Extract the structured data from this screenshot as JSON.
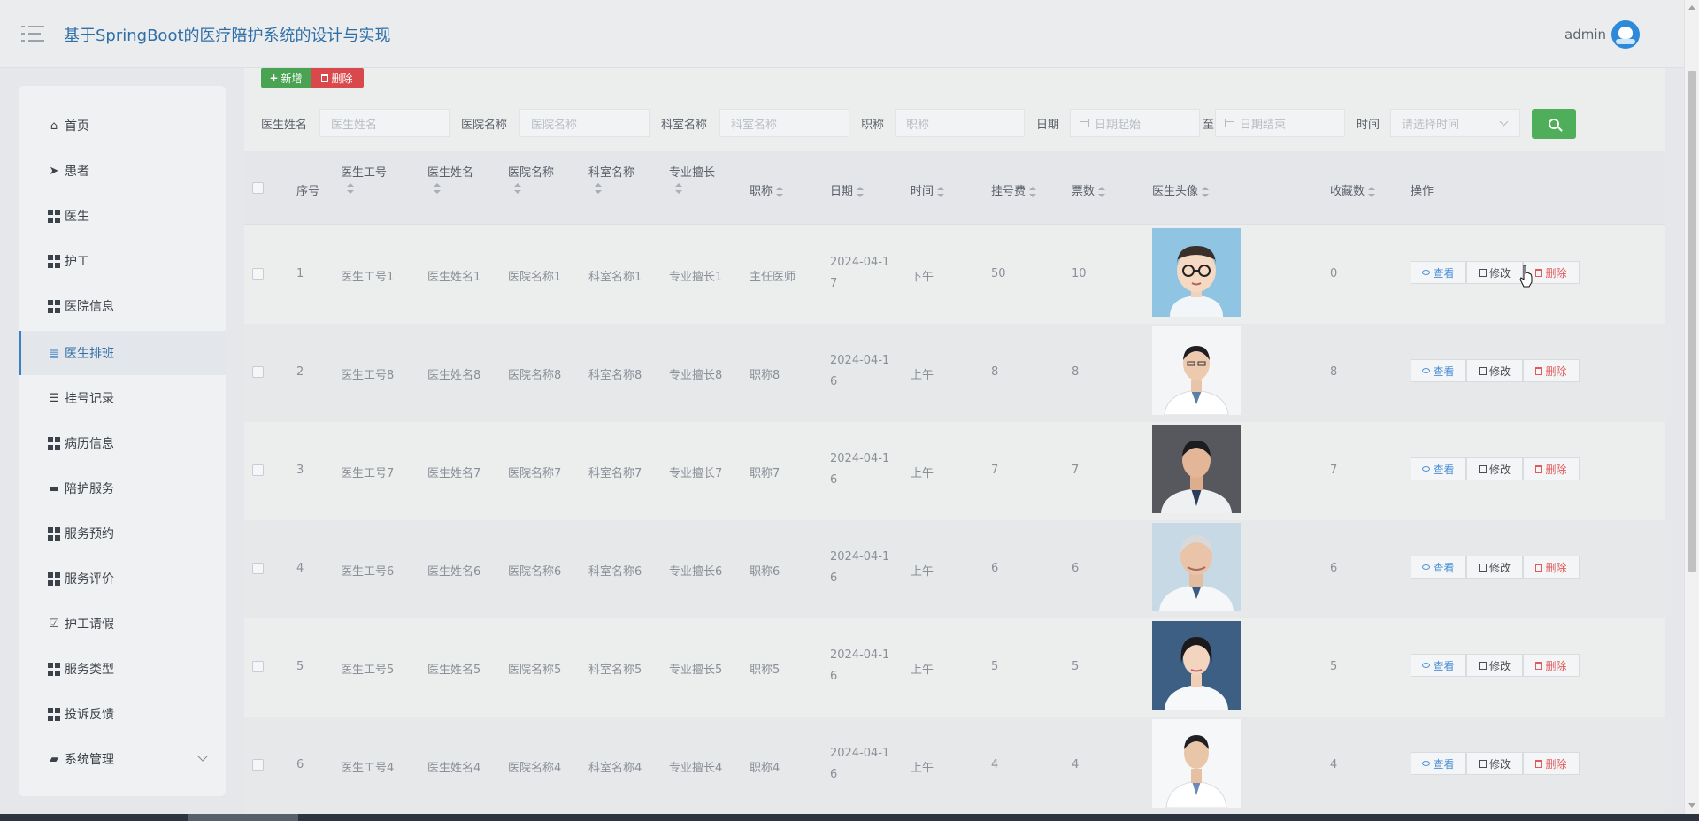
{
  "header": {
    "title": "基于SpringBoot的医疗陪护系统的设计与实现",
    "user": "admin"
  },
  "sidebar": {
    "items": [
      {
        "label": "首页",
        "icon": "home-icon"
      },
      {
        "label": "患者",
        "icon": "paper-plane-icon"
      },
      {
        "label": "医生",
        "icon": "grid-icon"
      },
      {
        "label": "护工",
        "icon": "grid-icon"
      },
      {
        "label": "医院信息",
        "icon": "grid-icon"
      },
      {
        "label": "医生排班",
        "icon": "clipboard-icon",
        "active": true
      },
      {
        "label": "挂号记录",
        "icon": "sliders-icon"
      },
      {
        "label": "病历信息",
        "icon": "grid-icon"
      },
      {
        "label": "陪护服务",
        "icon": "monitor-icon"
      },
      {
        "label": "服务预约",
        "icon": "grid-icon"
      },
      {
        "label": "服务评价",
        "icon": "grid-icon"
      },
      {
        "label": "护工请假",
        "icon": "checklist-icon"
      },
      {
        "label": "服务类型",
        "icon": "grid-icon"
      },
      {
        "label": "投诉反馈",
        "icon": "grid-icon"
      },
      {
        "label": "系统管理",
        "icon": "briefcase-icon"
      }
    ]
  },
  "toolbar": {
    "add_label": "新增",
    "delete_label": "删除"
  },
  "search": {
    "doctor_name_label": "医生姓名",
    "doctor_name_placeholder": "医生姓名",
    "hospital_label": "医院名称",
    "hospital_placeholder": "医院名称",
    "dept_label": "科室名称",
    "dept_placeholder": "科室名称",
    "title_label": "职称",
    "title_placeholder": "职称",
    "date_label": "日期",
    "date_start_placeholder": "日期起始",
    "date_to": "至",
    "date_end_placeholder": "日期结束",
    "time_label": "时间",
    "time_placeholder": "请选择时间"
  },
  "table": {
    "headers": {
      "index": "序号",
      "doctor_no": "医生工号",
      "doctor_name": "医生姓名",
      "hospital": "医院名称",
      "dept": "科室名称",
      "specialty": "专业擅长",
      "title": "职称",
      "date": "日期",
      "time": "时间",
      "fee": "挂号费",
      "tickets": "票数",
      "photo": "医生头像",
      "favorites": "收藏数",
      "actions": "操作"
    },
    "actions": {
      "view": "查看",
      "edit": "修改",
      "delete": "删除"
    },
    "rows": [
      {
        "index": "1",
        "doctor_no": "医生工号1",
        "doctor_name": "医生姓名1",
        "hospital": "医院名称1",
        "dept": "科室名称1",
        "specialty": "专业擅长1",
        "title": "主任医师",
        "date_a": "2024-04-1",
        "date_b": "7",
        "time": "下午",
        "fee": "50",
        "tickets": "10",
        "favorites": "0",
        "photo": "cartoon-doctor"
      },
      {
        "index": "2",
        "doctor_no": "医生工号8",
        "doctor_name": "医生姓名8",
        "hospital": "医院名称8",
        "dept": "科室名称8",
        "specialty": "专业擅长8",
        "title": "职称8",
        "date_a": "2024-04-1",
        "date_b": "6",
        "time": "上午",
        "fee": "8",
        "tickets": "8",
        "favorites": "8",
        "photo": "doctor-white-bg"
      },
      {
        "index": "3",
        "doctor_no": "医生工号7",
        "doctor_name": "医生姓名7",
        "hospital": "医院名称7",
        "dept": "科室名称7",
        "specialty": "专业擅长7",
        "title": "职称7",
        "date_a": "2024-04-1",
        "date_b": "6",
        "time": "上午",
        "fee": "7",
        "tickets": "7",
        "favorites": "7",
        "photo": "doctor-grey-bg"
      },
      {
        "index": "4",
        "doctor_no": "医生工号6",
        "doctor_name": "医生姓名6",
        "hospital": "医院名称6",
        "dept": "科室名称6",
        "specialty": "专业擅长6",
        "title": "职称6",
        "date_a": "2024-04-1",
        "date_b": "6",
        "time": "上午",
        "fee": "6",
        "tickets": "6",
        "favorites": "6",
        "photo": "doctor-elder-blue-bg"
      },
      {
        "index": "5",
        "doctor_no": "医生工号5",
        "doctor_name": "医生姓名5",
        "hospital": "医院名称5",
        "dept": "科室名称5",
        "specialty": "专业擅长5",
        "title": "职称5",
        "date_a": "2024-04-1",
        "date_b": "6",
        "time": "上午",
        "fee": "5",
        "tickets": "5",
        "favorites": "5",
        "photo": "doctor-female-blue-bg"
      },
      {
        "index": "6",
        "doctor_no": "医生工号4",
        "doctor_name": "医生姓名4",
        "hospital": "医院名称4",
        "dept": "科室名称4",
        "specialty": "专业擅长4",
        "title": "职称4",
        "date_a": "2024-04-1",
        "date_b": "6",
        "time": "上午",
        "fee": "4",
        "tickets": "4",
        "favorites": "4",
        "photo": "doctor-white-bg-2"
      }
    ]
  },
  "colors": {
    "primary": "#2f6fa8",
    "success": "#4aa253",
    "danger": "#d9484a"
  }
}
